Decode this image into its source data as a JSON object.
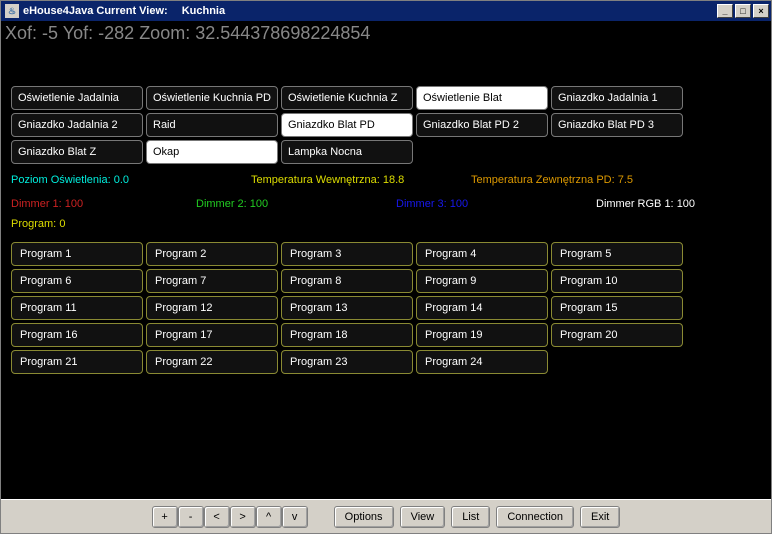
{
  "window": {
    "title_prefix": "eHouse4Java Current View:",
    "view_name": "Kuchnia"
  },
  "coords": {
    "xof_label": "Xof:",
    "xof": "-5",
    "yof_label": "Yof:",
    "yof": "-282",
    "zoom_label": "Zoom:",
    "zoom": "32.544378698224854"
  },
  "devices": [
    {
      "label": "Oświetlenie Jadalnia",
      "on": false
    },
    {
      "label": "Oświetlenie Kuchnia PD",
      "on": false
    },
    {
      "label": "Oświetlenie Kuchnia  Z",
      "on": false
    },
    {
      "label": "Oświetlenie Blat",
      "on": true
    },
    {
      "label": "Gniazdko Jadalnia 1",
      "on": false
    },
    {
      "label": "Gniazdko Jadalnia 2",
      "on": false
    },
    {
      "label": "Raid",
      "on": false
    },
    {
      "label": "Gniazdko Blat PD",
      "on": true
    },
    {
      "label": "Gniazdko Blat PD 2",
      "on": false
    },
    {
      "label": "Gniazdko Blat PD 3",
      "on": false
    },
    {
      "label": "Gniazdko Blat Z",
      "on": false
    },
    {
      "label": "Okap",
      "on": true
    },
    {
      "label": "Lampka Nocna",
      "on": false
    }
  ],
  "status1": {
    "light_level": {
      "label": "Poziom Oświetlenia:",
      "value": "0.0"
    },
    "temp_in": {
      "label": "Temperatura Wewnętrzna:",
      "value": "18.8"
    },
    "temp_out": {
      "label": "Temperatura Zewnętrzna PD:",
      "value": "7.5"
    }
  },
  "status2": {
    "d1": {
      "label": "Dimmer 1:",
      "value": "100"
    },
    "d2": {
      "label": "Dimmer 2:",
      "value": "100"
    },
    "d3": {
      "label": "Dimmer 3:",
      "value": "100"
    },
    "drgb": {
      "label": "Dimmer RGB 1:",
      "value": "100"
    }
  },
  "program": {
    "label": "Program:",
    "value": "0"
  },
  "programs": [
    "Program 1",
    "Program 2",
    "Program 3",
    "Program 4",
    "Program 5",
    "Program 6",
    "Program 7",
    "Program 8",
    "Program 9",
    "Program 10",
    "Program 11",
    "Program 12",
    "Program 13",
    "Program 14",
    "Program 15",
    "Program 16",
    "Program 17",
    "Program 18",
    "Program 19",
    "Program 20",
    "Program 21",
    "Program 22",
    "Program 23",
    "Program 24"
  ],
  "bottom": {
    "nav": [
      "+",
      "-",
      "<",
      ">",
      "^",
      "v"
    ],
    "actions": [
      "Options",
      "View",
      "List",
      "Connection",
      "Exit"
    ]
  }
}
